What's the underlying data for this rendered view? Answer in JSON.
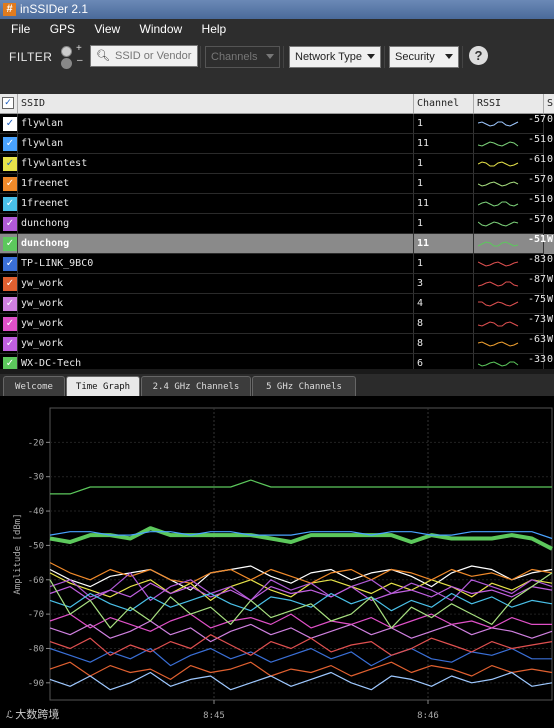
{
  "window": {
    "title": "inSSIDer 2.1",
    "icon": "hash-icon"
  },
  "menu": [
    "File",
    "GPS",
    "View",
    "Window",
    "Help"
  ],
  "filter": {
    "label": "FILTER",
    "search_placeholder": "SSID or Vendor",
    "channels_label": "Channels",
    "network_type_label": "Network Type",
    "security_label": "Security",
    "help_label": "?"
  },
  "table": {
    "headers": {
      "ssid": "SSID",
      "channel": "Channel",
      "rssi": "RSSI",
      "security": "S"
    },
    "rows": [
      {
        "ssid": "flywlan",
        "channel": "1",
        "rssi": "-57",
        "sec": "0",
        "color": "#ffffff",
        "spark": "#9ec8ff"
      },
      {
        "ssid": "flywlan",
        "channel": "11",
        "rssi": "-51",
        "sec": "0",
        "color": "#4aa3ff",
        "spark": "#7dd37a"
      },
      {
        "ssid": "flywlantest",
        "channel": "1",
        "rssi": "-61",
        "sec": "0",
        "color": "#e7e34a",
        "spark": "#e7e34a"
      },
      {
        "ssid": "1freenet",
        "channel": "1",
        "rssi": "-57",
        "sec": "0",
        "color": "#f08a2a",
        "spark": "#a8e080"
      },
      {
        "ssid": "1freenet",
        "channel": "11",
        "rssi": "-51",
        "sec": "0",
        "color": "#4ac0e8",
        "spark": "#7dd37a"
      },
      {
        "ssid": "dunchong",
        "channel": "1",
        "rssi": "-57",
        "sec": "0",
        "color": "#b15ad8",
        "spark": "#7dd37a"
      },
      {
        "ssid": "dunchong",
        "channel": "11",
        "rssi": "-51",
        "sec": "W",
        "color": "#5cc85c",
        "spark": "#5cc85c"
      },
      {
        "ssid": "TP-LINK_9BC0",
        "channel": "1",
        "rssi": "-83",
        "sec": "0",
        "color": "#3a6fd6",
        "spark": "#e05050"
      },
      {
        "ssid": "yw_work",
        "channel": "3",
        "rssi": "-87",
        "sec": "W",
        "color": "#e06030",
        "spark": "#e05050"
      },
      {
        "ssid": "yw_work",
        "channel": "4",
        "rssi": "-75",
        "sec": "W",
        "color": "#d080e0",
        "spark": "#e05050"
      },
      {
        "ssid": "yw_work",
        "channel": "8",
        "rssi": "-73",
        "sec": "W",
        "color": "#e050c8",
        "spark": "#e05050"
      },
      {
        "ssid": "yw_work",
        "channel": "8",
        "rssi": "-63",
        "sec": "W",
        "color": "#c060e0",
        "spark": "#f0a030"
      },
      {
        "ssid": "WX-DC-Tech",
        "channel": "6",
        "rssi": "-33",
        "sec": "0",
        "color": "#5cc85c",
        "spark": "#5cc85c"
      }
    ]
  },
  "tabs": [
    "Welcome",
    "Time Graph",
    "2.4 GHz Channels",
    "5 GHz Channels"
  ],
  "active_tab": "Time Graph",
  "watermark": "大数跨境",
  "chart_data": {
    "type": "line",
    "ylabel": "Amplitude [dBm]",
    "ylim": [
      -95,
      -10
    ],
    "yticks": [
      -20,
      -30,
      -40,
      -50,
      -60,
      -70,
      -80,
      -90
    ],
    "xticks": [
      "8:45",
      "8:46"
    ],
    "series": [
      {
        "color": "#5cc85c",
        "values": [
          -35,
          -35,
          -33,
          -33,
          -33,
          -33,
          -33,
          -33,
          -33,
          -33,
          -31,
          -33,
          -33,
          -33,
          -33,
          -33,
          -33,
          -33,
          -33,
          -33,
          -33,
          -33,
          -33,
          -33,
          -33,
          -33
        ]
      },
      {
        "color": "#5cc85c",
        "values": [
          -48,
          -49,
          -47,
          -47,
          -48,
          -45,
          -47,
          -47,
          -47,
          -47,
          -47,
          -48,
          -49,
          -47,
          -47,
          -47,
          -47,
          -47,
          -49,
          -47,
          -48,
          -48,
          -48,
          -47,
          -48,
          -51
        ]
      },
      {
        "color": "#4aa3ff",
        "values": [
          -47,
          -46,
          -46,
          -47,
          -47,
          -46,
          -46,
          -47,
          -46,
          -46,
          -47,
          -47,
          -47,
          -46,
          -46,
          -46,
          -47,
          -46,
          -46,
          -47,
          -47,
          -46,
          -46,
          -46,
          -46,
          -48
        ]
      },
      {
        "color": "#ffffff",
        "values": [
          -57,
          -60,
          -62,
          -59,
          -58,
          -57,
          -60,
          -63,
          -58,
          -57,
          -56,
          -59,
          -61,
          -58,
          -57,
          -60,
          -58,
          -57,
          -59,
          -62,
          -58,
          -56,
          -57,
          -60,
          -58,
          -57
        ]
      },
      {
        "color": "#e7e34a",
        "values": [
          -58,
          -61,
          -63,
          -65,
          -62,
          -60,
          -64,
          -61,
          -66,
          -62,
          -60,
          -63,
          -65,
          -61,
          -60,
          -62,
          -64,
          -61,
          -63,
          -60,
          -62,
          -65,
          -61,
          -63,
          -60,
          -61
        ]
      },
      {
        "color": "#f08a2a",
        "values": [
          -55,
          -58,
          -60,
          -57,
          -59,
          -57,
          -60,
          -61,
          -58,
          -57,
          -60,
          -57,
          -59,
          -61,
          -58,
          -57,
          -60,
          -57,
          -58,
          -60,
          -57,
          -59,
          -58,
          -60,
          -57,
          -58
        ]
      },
      {
        "color": "#b15ad8",
        "values": [
          -62,
          -60,
          -65,
          -63,
          -58,
          -66,
          -62,
          -60,
          -64,
          -62,
          -66,
          -60,
          -63,
          -61,
          -65,
          -62,
          -60,
          -64,
          -61,
          -63,
          -66,
          -60,
          -62,
          -64,
          -60,
          -62
        ]
      },
      {
        "color": "#3a6fd6",
        "values": [
          -80,
          -82,
          -84,
          -81,
          -83,
          -80,
          -85,
          -82,
          -80,
          -83,
          -81,
          -84,
          -82,
          -80,
          -83,
          -81,
          -85,
          -82,
          -80,
          -83,
          -84,
          -81,
          -82,
          -80,
          -83,
          -83
        ]
      },
      {
        "color": "#e06030",
        "values": [
          -86,
          -84,
          -88,
          -85,
          -87,
          -86,
          -89,
          -85,
          -87,
          -86,
          -84,
          -88,
          -86,
          -87,
          -85,
          -88,
          -86,
          -84,
          -87,
          -85,
          -86,
          -88,
          -85,
          -87,
          -86,
          -87
        ]
      },
      {
        "color": "#d080e0",
        "values": [
          -74,
          -76,
          -73,
          -77,
          -75,
          -72,
          -76,
          -74,
          -78,
          -75,
          -73,
          -76,
          -74,
          -77,
          -75,
          -73,
          -76,
          -74,
          -77,
          -75,
          -73,
          -76,
          -74,
          -75,
          -77,
          -75
        ]
      },
      {
        "color": "#e050c8",
        "values": [
          -72,
          -70,
          -74,
          -71,
          -73,
          -75,
          -72,
          -70,
          -74,
          -72,
          -71,
          -73,
          -70,
          -74,
          -72,
          -73,
          -71,
          -74,
          -72,
          -70,
          -73,
          -72,
          -74,
          -71,
          -73,
          -73
        ]
      },
      {
        "color": "#c060e0",
        "values": [
          -64,
          -62,
          -66,
          -63,
          -65,
          -61,
          -64,
          -62,
          -65,
          -63,
          -66,
          -62,
          -64,
          -63,
          -65,
          -62,
          -66,
          -64,
          -63,
          -65,
          -62,
          -64,
          -63,
          -65,
          -62,
          -63
        ]
      },
      {
        "color": "#4ac0e8",
        "values": [
          -66,
          -68,
          -64,
          -67,
          -69,
          -65,
          -68,
          -66,
          -64,
          -67,
          -69,
          -65,
          -66,
          -68,
          -64,
          -67,
          -65,
          -69,
          -66,
          -68,
          -64,
          -67,
          -65,
          -68,
          -66,
          -67
        ]
      },
      {
        "color": "#e05050",
        "values": [
          -78,
          -80,
          -77,
          -82,
          -79,
          -81,
          -78,
          -80,
          -76,
          -79,
          -82,
          -78,
          -80,
          -77,
          -81,
          -79,
          -78,
          -82,
          -80,
          -77,
          -79,
          -81,
          -78,
          -80,
          -79,
          -78
        ]
      },
      {
        "color": "#a8e080",
        "values": [
          -60,
          -70,
          -66,
          -74,
          -68,
          -72,
          -65,
          -70,
          -68,
          -73,
          -66,
          -71,
          -69,
          -67,
          -72,
          -70,
          -65,
          -74,
          -68,
          -71,
          -67,
          -70,
          -73,
          -66,
          -62,
          -58
        ]
      },
      {
        "color": "#9ec8ff",
        "values": [
          -89,
          -91,
          -88,
          -92,
          -90,
          -87,
          -91,
          -89,
          -88,
          -92,
          -90,
          -88,
          -91,
          -89,
          -87,
          -90,
          -92,
          -88,
          -89,
          -91,
          -88,
          -90,
          -89,
          -87,
          -91,
          -90
        ]
      }
    ]
  }
}
